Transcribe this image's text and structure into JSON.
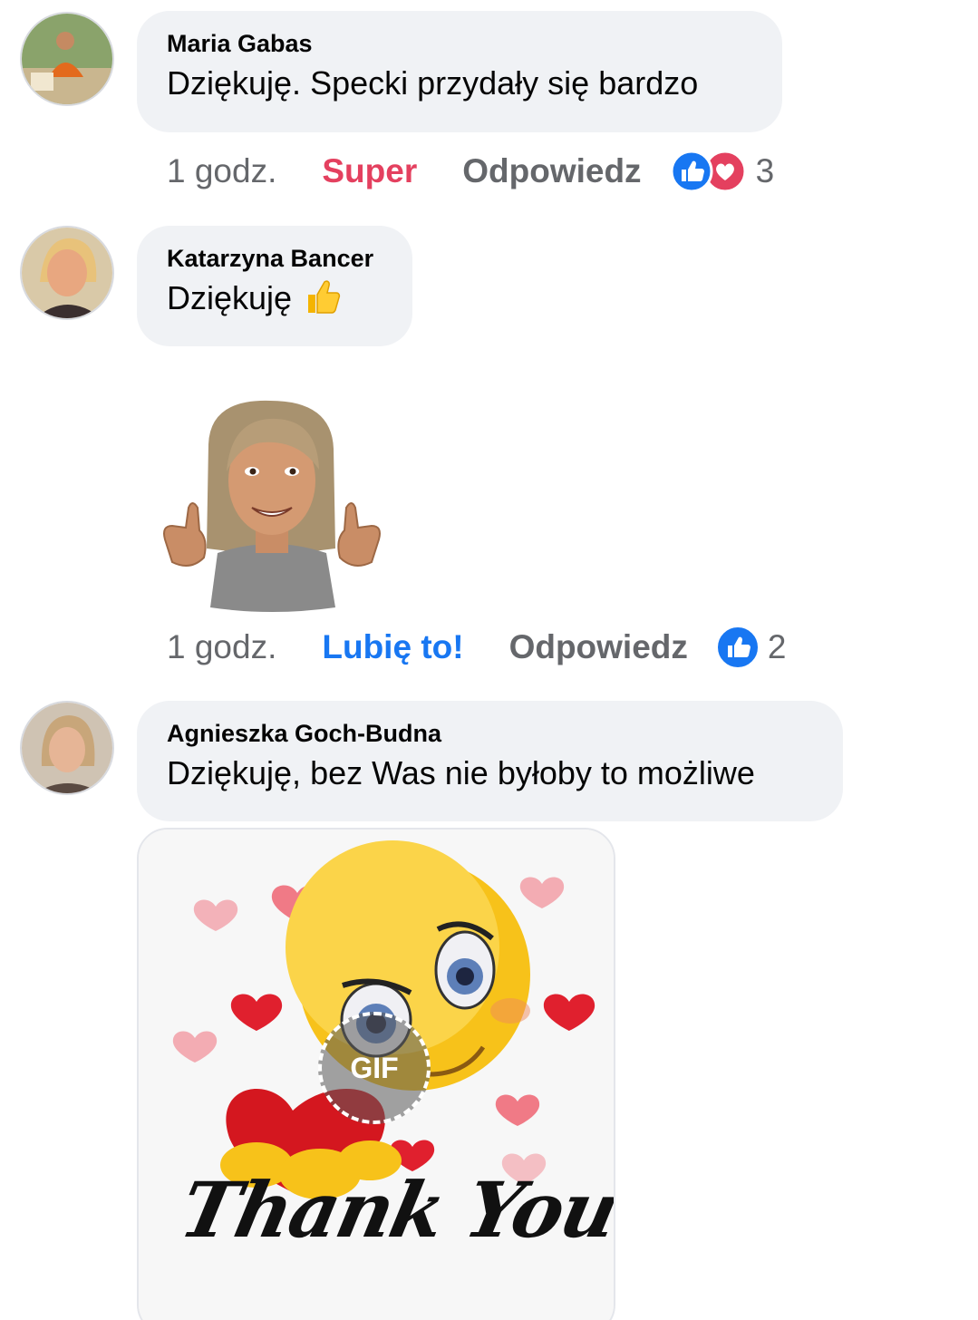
{
  "comments": [
    {
      "author": "Maria Gabas",
      "text": "Dziękuję. Specki przydały się bardzo",
      "time": "1 godz.",
      "reaction_label": "Super",
      "reply_label": "Odpowiedz",
      "reaction_icons": [
        "like-icon",
        "love-icon"
      ],
      "reaction_count": "3"
    },
    {
      "author": "Katarzyna Bancer",
      "text": "Dziękuję",
      "inline_emoji": "thumbs-up-emoji",
      "attachment": "avatar-sticker-thumbs-up",
      "time": "1 godz.",
      "reaction_label": "Lubię to!",
      "reply_label": "Odpowiedz",
      "reaction_icons": [
        "like-icon"
      ],
      "reaction_count": "2"
    },
    {
      "author": "Agnieszka Goch-Budna",
      "text": "Dziękuję, bez Was nie byłoby to możliwe",
      "attachment": "thank-you-gif",
      "gif_badge": "GIF",
      "gif_caption": "Thank You"
    }
  ],
  "colors": {
    "bubble": "#f0f2f5",
    "meta": "#65676b",
    "like_blue": "#1877f2",
    "love_red": "#e4405f"
  }
}
